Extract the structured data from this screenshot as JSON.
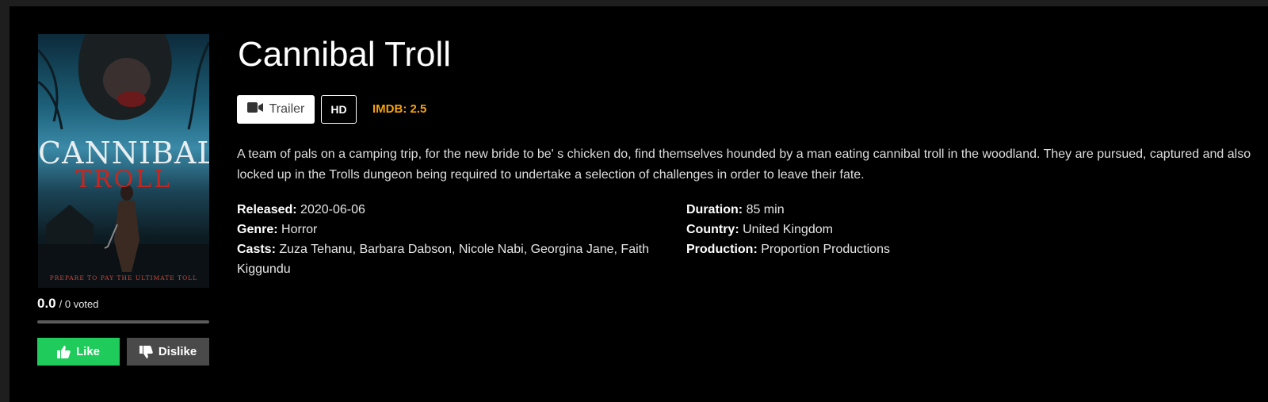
{
  "movie": {
    "title": "Cannibal Troll",
    "poster": {
      "title_line1": "CANNIBAL",
      "title_line2": "TROLL",
      "tagline": "PREPARE TO PAY THE ULTIMATE TOLL"
    },
    "rating": {
      "score": "0.0",
      "votes": "/ 0 voted",
      "fraction": 0
    },
    "buttons": {
      "trailer": "Trailer",
      "hd": "HD",
      "like": "Like",
      "dislike": "Dislike"
    },
    "imdb": "IMDB: 2.5",
    "description": "A team of pals on a camping trip, for the new bride to be' s chicken do, find themselves hounded by a man eating cannibal troll in the woodland. They are pursued, captured and also locked up in the Trolls dungeon being required to undertake a selection of challenges in order to leave their fate.",
    "details_left": {
      "released_label": "Released:",
      "released": "2020-06-06",
      "genre_label": "Genre:",
      "genre": "Horror",
      "casts_label": "Casts:",
      "casts": "Zuza Tehanu, Barbara Dabson, Nicole Nabi, Georgina Jane, Faith Kiggundu"
    },
    "details_right": {
      "duration_label": "Duration:",
      "duration": "85 min",
      "country_label": "Country:",
      "country": "United Kingdom",
      "production_label": "Production:",
      "production": "Proportion Productions"
    }
  },
  "icons": {
    "trailer": "video-camera-icon",
    "like": "thumbs-up-icon",
    "dislike": "thumbs-down-icon"
  },
  "colors": {
    "background": "#000000",
    "like": "#1ecb5b",
    "dislike": "#4a4a4a",
    "imdb": "#f5a10f"
  }
}
